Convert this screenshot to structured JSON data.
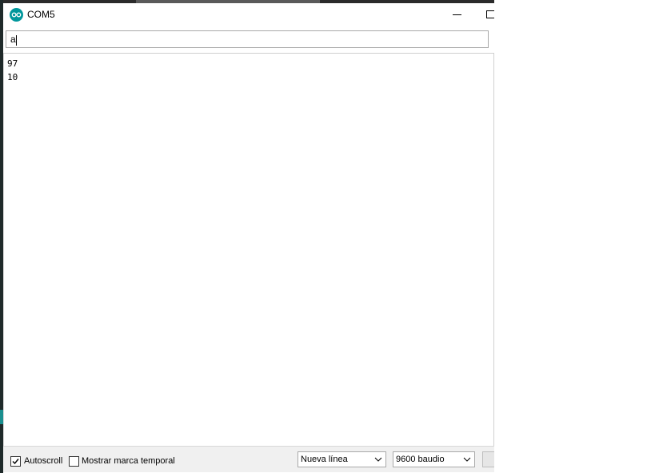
{
  "window": {
    "title": "COM5",
    "app_icon": "arduino-logo-icon",
    "accent_color": "#00979c"
  },
  "send": {
    "value": "a"
  },
  "output": {
    "lines": [
      "97",
      "10"
    ]
  },
  "status": {
    "autoscroll_label": "Autoscroll",
    "autoscroll_checked": true,
    "timestamp_label": "Mostrar marca temporal",
    "timestamp_checked": false,
    "line_ending": "Nueva línea",
    "baud_rate": "9600 baudio"
  }
}
